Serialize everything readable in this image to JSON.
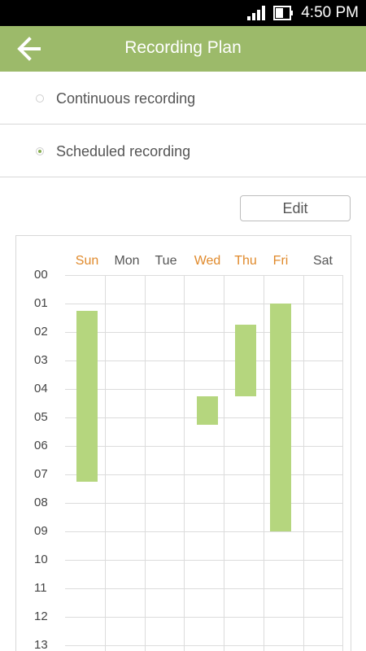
{
  "status_bar": {
    "time": "4:50 PM",
    "icons": [
      "signal-icon",
      "battery-icon"
    ]
  },
  "header": {
    "title": "Recording Plan",
    "back_icon": "arrow-left-icon"
  },
  "options": [
    {
      "label": "Continuous recording",
      "selected": false
    },
    {
      "label": "Scheduled recording",
      "selected": true
    }
  ],
  "edit_button": {
    "label": "Edit"
  },
  "schedule": {
    "days": [
      {
        "label": "Sun",
        "highlighted": true
      },
      {
        "label": "Mon",
        "highlighted": false
      },
      {
        "label": "Tue",
        "highlighted": false
      },
      {
        "label": "Wed",
        "highlighted": true
      },
      {
        "label": "Thu",
        "highlighted": true
      },
      {
        "label": "Fri",
        "highlighted": true
      },
      {
        "label": "Sat",
        "highlighted": false
      }
    ],
    "hours": [
      "00",
      "01",
      "02",
      "03",
      "04",
      "05",
      "06",
      "07",
      "08",
      "09",
      "10",
      "11",
      "12",
      "13"
    ],
    "recordings": [
      {
        "day": "Sun",
        "start_hour": 1.25,
        "end_hour": 7.25
      },
      {
        "day": "Wed",
        "start_hour": 4.25,
        "end_hour": 5.25
      },
      {
        "day": "Thu",
        "start_hour": 1.75,
        "end_hour": 4.25
      },
      {
        "day": "Fri",
        "start_hour": 1.0,
        "end_hour": 9.0
      }
    ]
  },
  "colors": {
    "accent": "#9cba6a",
    "block": "#b5d67e",
    "weekend_text": "#e08a2c"
  }
}
